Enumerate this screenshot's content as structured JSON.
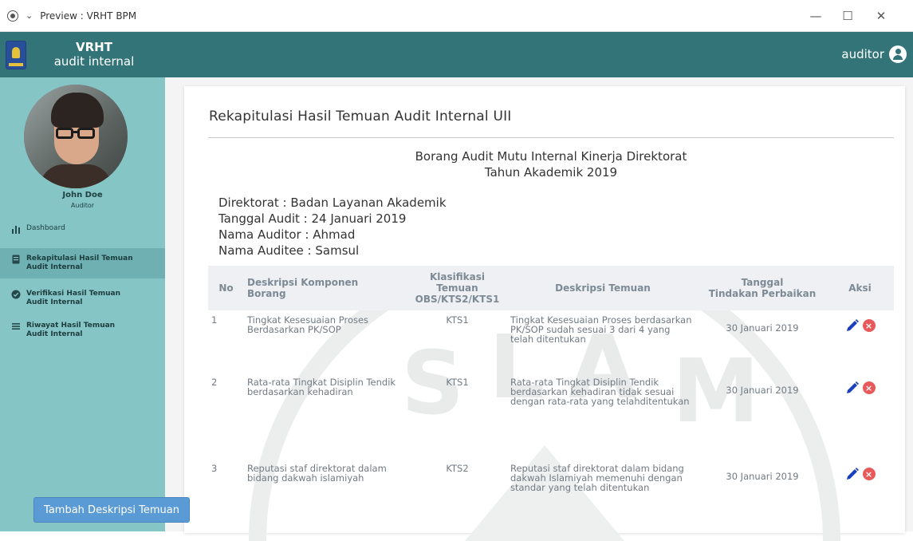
{
  "window": {
    "title": "Preview : VRHT BPM"
  },
  "brand": {
    "line1": "VRHT",
    "line2": "audit internal"
  },
  "header": {
    "user": "auditor"
  },
  "profile": {
    "name": "John Doe",
    "role": "Auditor"
  },
  "sidebar": {
    "items": [
      {
        "label": "Dashboard",
        "icon": "bar-chart-icon",
        "active": false
      },
      {
        "label": "Rekapitulasi Hasil Temuan",
        "label2": "Audit Internal",
        "icon": "document-icon",
        "active": true
      },
      {
        "label": "Verifikasi Hasil Temuan",
        "label2": "Audit Internal",
        "icon": "check-circle-icon",
        "active": false
      },
      {
        "label": "Riwayat Hasil Temuan",
        "label2": "Audit Internal",
        "icon": "list-icon",
        "active": false
      }
    ]
  },
  "main": {
    "title": "Rekapitulasi Hasil Temuan Audit Internal UII",
    "doc_title_1": "Borang Audit Mutu Internal Kinerja Direktorat",
    "doc_title_2": "Tahun Akademik 2019",
    "meta": {
      "direktorat": "Direktorat : Badan Layanan Akademik",
      "tanggal": "Tanggal Audit : 24 Januari 2019",
      "auditor": "Nama Auditor : Ahmad",
      "auditee": "Nama Auditee : Samsul"
    },
    "table": {
      "headers": {
        "no": "No",
        "komponen_1": "Deskripsi Komponen",
        "komponen_2": "Borang",
        "klasifikasi_1": "Klasifikasi Temuan",
        "klasifikasi_2": "OBS/KTS2/KTS1",
        "deskripsi": "Deskripsi Temuan",
        "tanggal_1": "Tanggal",
        "tanggal_2": "Tindakan Perbaikan",
        "aksi": "Aksi"
      },
      "rows": [
        {
          "no": "1",
          "komponen": "Tingkat Kesesuaian Proses Berdasarkan PK/SOP",
          "klasifikasi": "KTS1",
          "deskripsi": "Tingkat Kesesuaian Proses berdasarkan PK/SOP sudah sesuai 3 dari 4 yang telah ditentukan",
          "tanggal": "30 Januari 2019"
        },
        {
          "no": "2",
          "komponen": "Rata-rata Tingkat Disiplin Tendik berdasarkan kehadiran",
          "klasifikasi": "KTS1",
          "deskripsi": "Rata-rata Tingkat Disiplin Tendik berdasarkan kehadiran tidak sesuai dengan rata-rata yang telahditentukan",
          "tanggal": "30 Januari 2019"
        },
        {
          "no": "3",
          "komponen": "Reputasi staf direktorat dalam bidang dakwah islamiyah",
          "klasifikasi": "KTS2",
          "deskripsi": "Reputasi staf direktorat dalam bidang dakwah Islamiyah memenuhi dengan standar yang telah ditentukan",
          "tanggal": "30 Januari 2019"
        }
      ]
    },
    "add_button": "Tambah Deskripsi Temuan"
  },
  "colors": {
    "sidebar": "#86c5c6",
    "header": "#337478",
    "button": "#5b9bd5",
    "delete": "#e85a5a",
    "edit": "#1a3fbf"
  }
}
